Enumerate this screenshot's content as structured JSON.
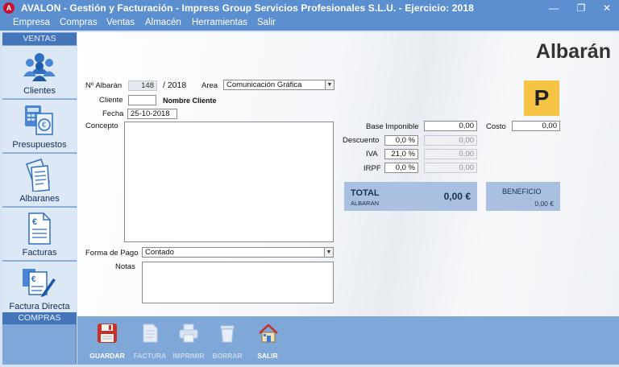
{
  "window": {
    "logo": "A",
    "title": "AVALON - Gestión y Facturación - Impress Group Servicios Profesionales S.L.U. - Ejercicio: 2018",
    "minimize": "—",
    "restore": "❐",
    "close": "✕"
  },
  "menu": [
    "Empresa",
    "Compras",
    "Ventas",
    "Almacén",
    "Herramientas",
    "Salir"
  ],
  "sidebar": {
    "ventas_header": "VENTAS",
    "compras_header": "COMPRAS",
    "items": [
      "Clientes",
      "Presupuestos",
      "Albaranes",
      "Facturas",
      "Factura Directa"
    ]
  },
  "form": {
    "title": "Albarán",
    "badge": "P",
    "numero_label": "Nº Albarán",
    "numero": "148",
    "anio": "/ 2018",
    "area_label": "Area",
    "area": "Comunicación Gráfica",
    "cliente_label": "Cliente",
    "cliente_codigo": "",
    "cliente_nombre": "Nombre Cliente",
    "fecha_label": "Fecha",
    "fecha": "25-10-2018",
    "concepto_label": "Concepto",
    "forma_pago_label": "Forma de Pago",
    "forma_pago": "Contado",
    "notas_label": "Notas"
  },
  "totals": {
    "base_label": "Base Imponible",
    "base": "0,00",
    "costo_label": "Costo",
    "costo": "0,00",
    "descuento_label": "Descuento",
    "descuento_pct": "0,0 %",
    "descuento": "0,00",
    "iva_label": "IVA",
    "iva_pct": "21,0 %",
    "iva": "0,00",
    "irpf_label": "IRPF",
    "irpf_pct": "0,0 %",
    "irpf": "0,00",
    "total_label": "TOTAL",
    "total_sub": "ALBARAN",
    "total": "0,00 €",
    "beneficio_label": "BENEFICIO",
    "beneficio": "0,00 €"
  },
  "toolbar": {
    "guardar": "GUARDAR",
    "factura": "FACTURA",
    "imprimir": "IMPRIMIR",
    "borrar": "BORRAR",
    "salir": "SALIR"
  },
  "colors": {
    "titlebar": "#5b8fd0",
    "sidebar_header": "#4475b8",
    "total_box": "#a9c0e0",
    "badge": "#f5c445"
  }
}
